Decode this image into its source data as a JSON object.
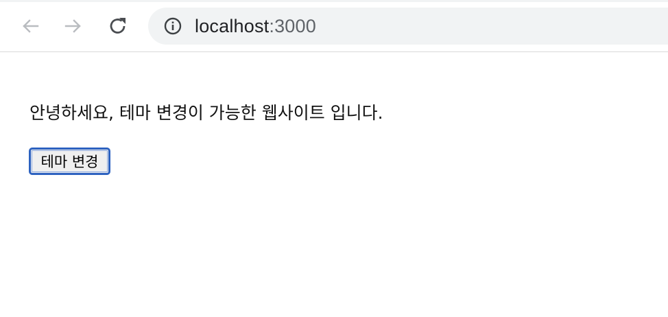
{
  "browser": {
    "address_bar": {
      "host": "localhost",
      "port": ":3000"
    },
    "icons": {
      "back": "arrow-left-icon",
      "forward": "arrow-right-icon",
      "reload": "reload-icon",
      "site_info": "info-icon"
    }
  },
  "page": {
    "greeting": "안녕하세요, 테마 변경이 가능한 웹사이트 입니다.",
    "theme_button_label": "테마 변경"
  },
  "colors": {
    "button_focus_border": "#2d62c0",
    "omnibox_bg": "#f1f3f4"
  }
}
